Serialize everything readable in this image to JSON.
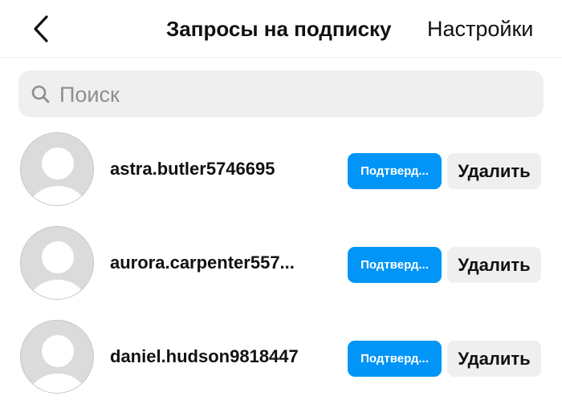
{
  "header": {
    "back_icon": "chevron-left-icon",
    "title": "Запросы на подписку",
    "settings_label": "Настройки"
  },
  "search": {
    "icon": "search-icon",
    "placeholder": "Поиск",
    "value": ""
  },
  "requests": [
    {
      "username": "astra.butler5746695",
      "confirm_label": "Подтверд...",
      "delete_label": "Удалить"
    },
    {
      "username": "aurora.carpenter557...",
      "confirm_label": "Подтверд...",
      "delete_label": "Удалить"
    },
    {
      "username": "daniel.hudson9818447",
      "confirm_label": "Подтверд...",
      "delete_label": "Удалить"
    }
  ],
  "colors": {
    "accent": "#0095f6",
    "secondary_button": "#efefef",
    "avatar_placeholder": "#dbdbdb"
  }
}
